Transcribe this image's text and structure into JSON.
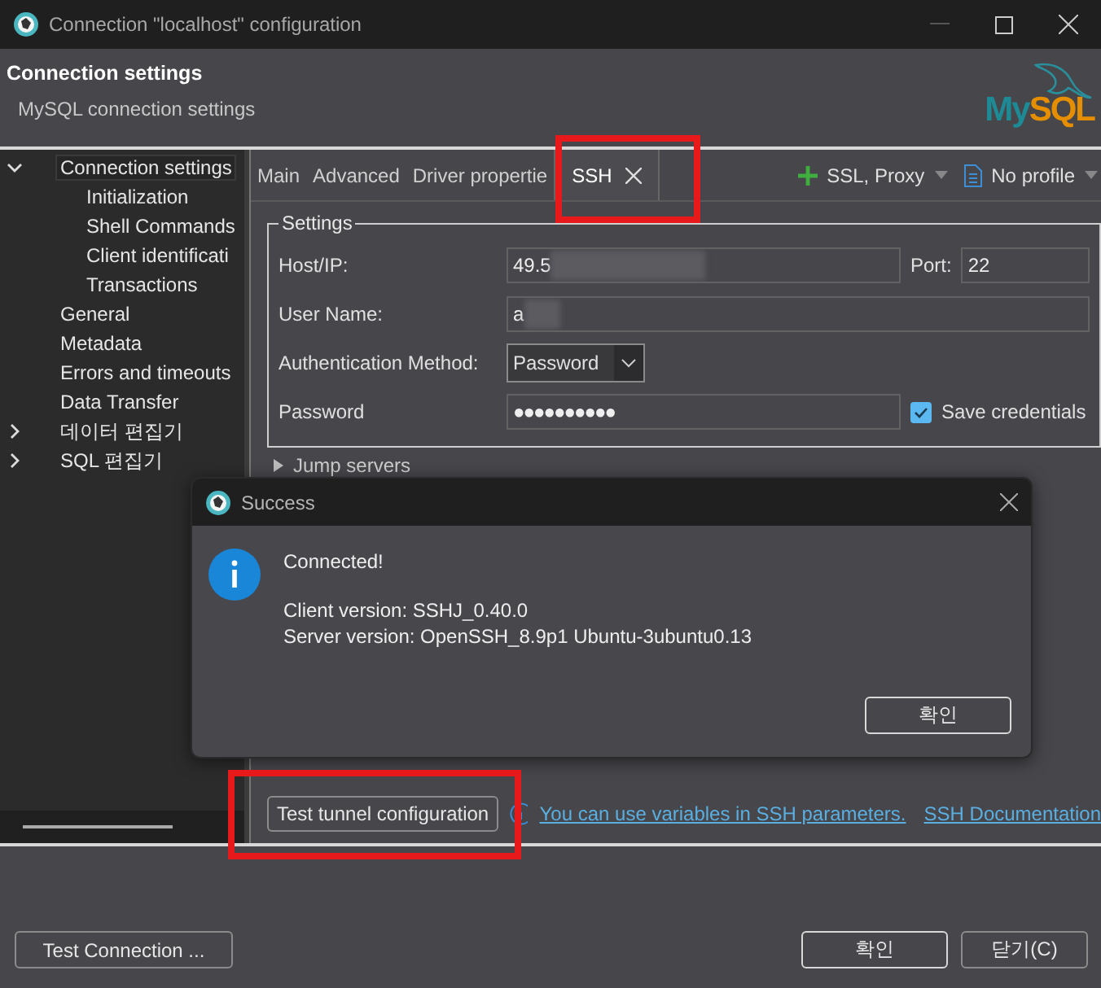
{
  "window": {
    "title": "Connection \"localhost\" configuration"
  },
  "header": {
    "title": "Connection settings",
    "subtitle": "MySQL connection settings",
    "logo": "MySQL"
  },
  "sidebar": {
    "items": [
      {
        "label": "Connection settings",
        "expanded": true,
        "selected": true,
        "children": [
          {
            "label": "Initialization",
            "selected": false
          },
          {
            "label": "Shell Commands",
            "selected": false
          },
          {
            "label": "Client identificati",
            "selected": false
          },
          {
            "label": "Transactions",
            "selected": false
          }
        ]
      },
      {
        "label": "General",
        "selected": false
      },
      {
        "label": "Metadata",
        "selected": false
      },
      {
        "label": "Errors and timeouts",
        "selected": false
      },
      {
        "label": "Data Transfer",
        "selected": false
      },
      {
        "label": "데이터 편집기",
        "expanded": false,
        "selected": false
      },
      {
        "label": "SQL 편집기",
        "expanded": false,
        "selected": false
      }
    ]
  },
  "tabs": [
    {
      "label": "Main",
      "selected": false
    },
    {
      "label": "Advanced",
      "selected": false
    },
    {
      "label": "Driver propertie",
      "selected": false
    },
    {
      "label": "SSH",
      "selected": true,
      "closable": true
    }
  ],
  "toolbar": {
    "add_button": "SSL, Proxy",
    "profile_button": "No profile"
  },
  "settings": {
    "title": "Settings",
    "host_label": "Host/IP:",
    "host_value": "49.5",
    "port_label": "Port:",
    "port_value": "22",
    "user_label": "User Name:",
    "user_value": "a",
    "auth_label": "Authentication Method:",
    "auth_value": "Password",
    "password_label": "Password",
    "password_value": "●●●●●●●●●●",
    "save_credentials": {
      "label": "Save credentials",
      "checked": true
    }
  },
  "jump_servers": {
    "label": "Jump servers",
    "expanded": false
  },
  "tunnel": {
    "button": "Test tunnel configuration",
    "link": "You can use variables in SSH parameters.",
    "doc_link": "SSH Documentation"
  },
  "dialog": {
    "title": "Success",
    "heading": "Connected!",
    "lines": [
      "Client version: SSHJ_0.40.0",
      "Server version: OpenSSH_8.9p1 Ubuntu-3ubuntu0.13"
    ],
    "button": "확인"
  },
  "footer": {
    "test_button": "Test Connection ...",
    "ok_button": "확인",
    "close_button": "닫기(C)"
  }
}
